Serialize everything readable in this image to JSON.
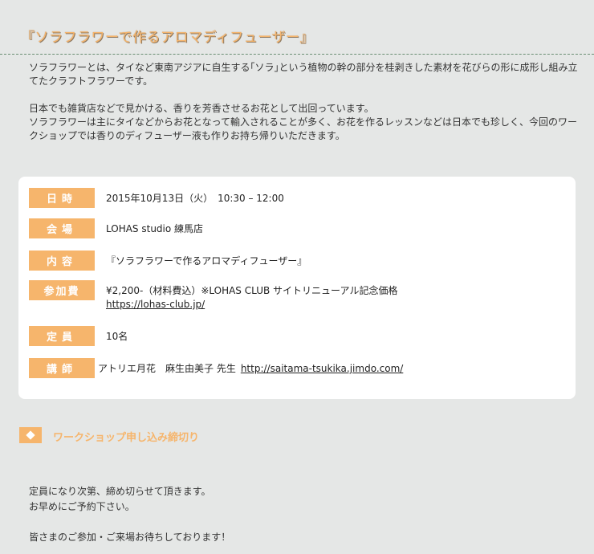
{
  "page_title": "『ソラフラワーで作るアロマディフューザー』",
  "intro": {
    "p1": "ソラフラワーとは、タイなど東南アジアに自生する｢ソラ｣という植物の幹の部分を桂剥きした素材を花びらの形に成形し組み立てたクラフトフラワーです。",
    "p2": "日本でも雑貨店などで見かける、香りを芳香させるお花として出回っています。",
    "p3": "ソラフラワーは主にタイなどからお花となって輸入されることが多く、お花を作るレッスンなどは日本でも珍しく、今回のワークショップでは香りのディフューザー液も作りお持ち帰りいただきます。"
  },
  "info": {
    "date": {
      "label": "日時",
      "value": "2015年10月13日（火）　10:30 – 12:00"
    },
    "venue": {
      "label": "会場",
      "value": "LOHAS studio 練馬店"
    },
    "content": {
      "label": "内容",
      "value": "『ソラフラワーで作るアロマディフューザー』"
    },
    "fee": {
      "label": "参加費",
      "value": "¥2,200-（材料費込）※LOHAS CLUB サイトリニューアル記念価格",
      "link": "https://lohas-club.jp/"
    },
    "capacity": {
      "label": "定員",
      "value": "10名"
    },
    "instructor": {
      "label": "講師",
      "value": "アトリエ月花　麻生由美子 先生",
      "link": "http://saitama-tsukika.jimdo.com/"
    }
  },
  "deadline": {
    "title": "ワークショップ申し込み締切り",
    "line1": "定員になり次第、締め切らせて頂きます。",
    "line2": "お早めにご予約下さい。",
    "line3": "皆さまのご参加・ご来場お待ちしております！"
  },
  "colors": {
    "accent": "#f6b56c",
    "background": "#e5e7e6",
    "card": "#ffffff",
    "rule": "#6a8f73"
  }
}
